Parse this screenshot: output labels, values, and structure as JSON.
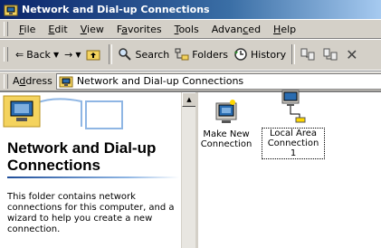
{
  "window": {
    "title": "Network and Dial-up Connections"
  },
  "menu": [
    {
      "pre": "",
      "key": "F",
      "post": "ile"
    },
    {
      "pre": "",
      "key": "E",
      "post": "dit"
    },
    {
      "pre": "",
      "key": "V",
      "post": "iew"
    },
    {
      "pre": "F",
      "key": "a",
      "post": "vorites"
    },
    {
      "pre": "",
      "key": "T",
      "post": "ools"
    },
    {
      "pre": "Advan",
      "key": "c",
      "post": "ed"
    },
    {
      "pre": "",
      "key": "H",
      "post": "elp"
    }
  ],
  "toolbar": {
    "back_label": "Back",
    "search_label": "Search",
    "folders_label": "Folders",
    "history_label": "History"
  },
  "address": {
    "label_pre": "A",
    "label_key": "d",
    "label_post": "dress",
    "value": "Network and Dial-up Connections"
  },
  "left_pane": {
    "heading": "Network and Dial-up Connections",
    "description": "This folder contains network connections for this computer, and a wizard to help you create a new connection."
  },
  "items": [
    {
      "label": "Make New Connection",
      "icon": "make-new-connection-icon"
    },
    {
      "label": "Local Area Connection 1",
      "icon": "local-area-connection-icon"
    }
  ]
}
